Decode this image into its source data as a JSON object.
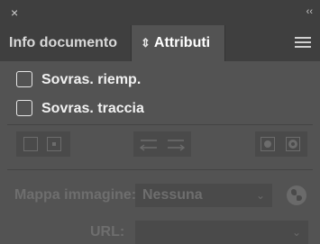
{
  "window": {
    "close_glyph": "×",
    "collapse_glyph": "‹‹"
  },
  "tabs": [
    {
      "label": "Info documento",
      "active": false
    },
    {
      "label": "Attributi",
      "active": true,
      "icon": "double-chevron-icon"
    }
  ],
  "checkboxes": [
    {
      "label": "Sovras. riemp.",
      "checked": false
    },
    {
      "label": "Sovras. traccia",
      "checked": false
    }
  ],
  "image_map": {
    "label": "Mappa immagine:",
    "value": "Nessuna",
    "enabled": false
  },
  "url": {
    "label": "URL:",
    "value": "",
    "enabled": false
  },
  "colors": {
    "panel_bg": "#535353",
    "header_bg": "#3f3f3f",
    "disabled_text": "#6e6e6e"
  }
}
